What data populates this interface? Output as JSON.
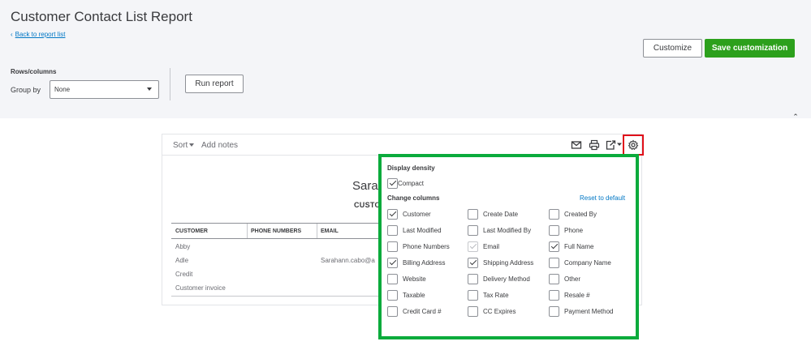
{
  "page": {
    "title": "Customer Contact List Report",
    "back_link": "Back to report list",
    "customize_label": "Customize",
    "save_label": "Save customization",
    "rows_columns_label": "Rows/columns",
    "group_by_label": "Group by",
    "group_by_value": "None",
    "run_report_label": "Run report"
  },
  "report": {
    "sort_label": "Sort",
    "add_notes_label": "Add notes",
    "company_name": "Sarah",
    "subtitle": "CUSTO",
    "columns": [
      "CUSTOMER",
      "PHONE NUMBERS",
      "EMAIL"
    ],
    "rows": [
      {
        "customer": "Abby",
        "phone": "",
        "email": ""
      },
      {
        "customer": "Adle",
        "phone": "",
        "email": "Sarahann.cabo@a"
      },
      {
        "customer": "Credit",
        "phone": "",
        "email": ""
      },
      {
        "customer": "Customer invoice",
        "phone": "",
        "email": ""
      }
    ]
  },
  "settings_panel": {
    "display_density_heading": "Display density",
    "compact_label": "Compact",
    "compact_checked": true,
    "change_columns_heading": "Change columns",
    "reset_label": "Reset to default",
    "columns": [
      {
        "label": "Customer",
        "checked": true,
        "disabled": false
      },
      {
        "label": "Create Date",
        "checked": false,
        "disabled": false
      },
      {
        "label": "Created By",
        "checked": false,
        "disabled": false
      },
      {
        "label": "Last Modified",
        "checked": false,
        "disabled": false
      },
      {
        "label": "Last Modified By",
        "checked": false,
        "disabled": false
      },
      {
        "label": "Phone",
        "checked": false,
        "disabled": false
      },
      {
        "label": "Phone Numbers",
        "checked": false,
        "disabled": false
      },
      {
        "label": "Email",
        "checked": true,
        "disabled": true
      },
      {
        "label": "Full Name",
        "checked": true,
        "disabled": false
      },
      {
        "label": "Billing Address",
        "checked": true,
        "disabled": false
      },
      {
        "label": "Shipping Address",
        "checked": true,
        "disabled": false
      },
      {
        "label": "Company Name",
        "checked": false,
        "disabled": false
      },
      {
        "label": "Website",
        "checked": false,
        "disabled": false
      },
      {
        "label": "Delivery Method",
        "checked": false,
        "disabled": false
      },
      {
        "label": "Other",
        "checked": false,
        "disabled": false
      },
      {
        "label": "Taxable",
        "checked": false,
        "disabled": false
      },
      {
        "label": "Tax Rate",
        "checked": false,
        "disabled": false
      },
      {
        "label": "Resale #",
        "checked": false,
        "disabled": false
      },
      {
        "label": "Credit Card #",
        "checked": false,
        "disabled": false
      },
      {
        "label": "CC Expires",
        "checked": false,
        "disabled": false
      },
      {
        "label": "Payment Method",
        "checked": false,
        "disabled": false
      }
    ]
  },
  "colors": {
    "accent_green": "#2ca01c",
    "highlight_green": "#0bab3c",
    "highlight_red": "#e0101a",
    "link_blue": "#0077c5"
  },
  "icons": [
    "chevron-left-icon",
    "chevron-down-icon",
    "chevron-up-icon",
    "mail-icon",
    "print-icon",
    "export-icon",
    "gear-icon"
  ]
}
